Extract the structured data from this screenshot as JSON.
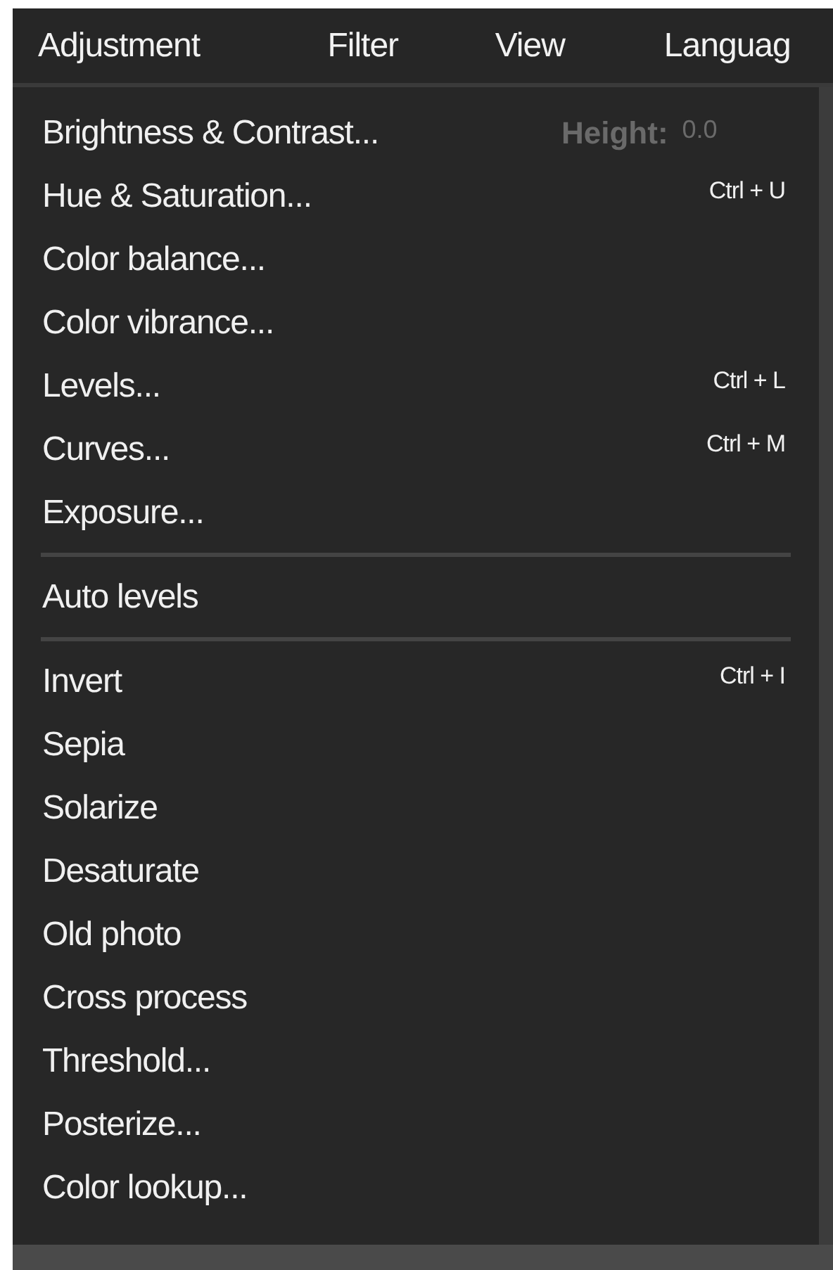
{
  "menubar": [
    {
      "label": "Adjustment"
    },
    {
      "label": "Filter"
    },
    {
      "label": "View"
    },
    {
      "label": "Languag"
    }
  ],
  "underlay": {
    "label": "Height:",
    "value": "0.0"
  },
  "menu": {
    "groups": [
      [
        {
          "label": "Brightness & Contrast..."
        },
        {
          "label": "Hue & Saturation...",
          "shortcut": "Ctrl + U"
        },
        {
          "label": "Color balance..."
        },
        {
          "label": "Color vibrance..."
        },
        {
          "label": "Levels...",
          "shortcut": "Ctrl + L"
        },
        {
          "label": "Curves...",
          "shortcut": "Ctrl + M"
        },
        {
          "label": "Exposure..."
        }
      ],
      [
        {
          "label": "Auto levels"
        }
      ],
      [
        {
          "label": "Invert",
          "shortcut": "Ctrl + I"
        },
        {
          "label": "Sepia"
        },
        {
          "label": "Solarize"
        },
        {
          "label": "Desaturate"
        },
        {
          "label": "Old photo"
        },
        {
          "label": "Cross process"
        },
        {
          "label": "Threshold..."
        },
        {
          "label": "Posterize..."
        },
        {
          "label": "Color lookup..."
        }
      ]
    ]
  }
}
